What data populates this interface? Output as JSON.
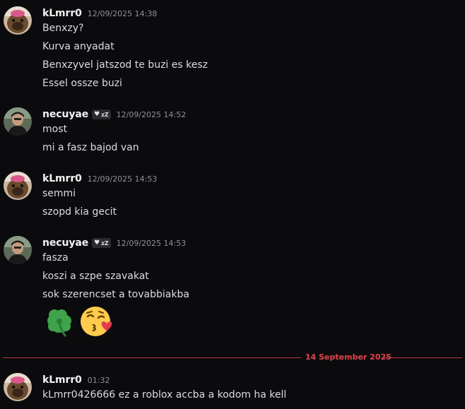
{
  "messages": [
    {
      "username": "kLmrr0",
      "timestamp": "12/09/2025 14:38",
      "lines": [
        "Benxzy?",
        "Kurva anyadat",
        "Benxzyvel jatszod te buzi es kesz",
        "Essel ossze buzi"
      ]
    },
    {
      "username": "necuyae",
      "badge": "zZ",
      "timestamp": "12/09/2025 14:52",
      "lines": [
        "most",
        "mi a fasz bajod van"
      ]
    },
    {
      "username": "kLmrr0",
      "timestamp": "12/09/2025 14:53",
      "lines": [
        "semmi",
        "szopd kia gecit"
      ]
    },
    {
      "username": "necuyae",
      "badge": "zZ",
      "timestamp": "12/09/2025 14:53",
      "lines": [
        "fasza",
        "koszi a szpe szavakat",
        "sok szerencset a tovabbiakba"
      ],
      "emojis": [
        "four-leaf-clover",
        "face-blowing-a-kiss"
      ]
    },
    {
      "username": "kLmrr0",
      "timestamp": "01:32",
      "lines": [
        "kLmrr0426666 ez a roblox accba a kodom ha kell"
      ]
    }
  ],
  "date_divider": "14 September 2025",
  "colors": {
    "background": "#0b0b0d",
    "divider": "#b8373c",
    "divider_text": "#e1454b",
    "username": "#f2f3f5",
    "timestamp": "#8e9199"
  }
}
